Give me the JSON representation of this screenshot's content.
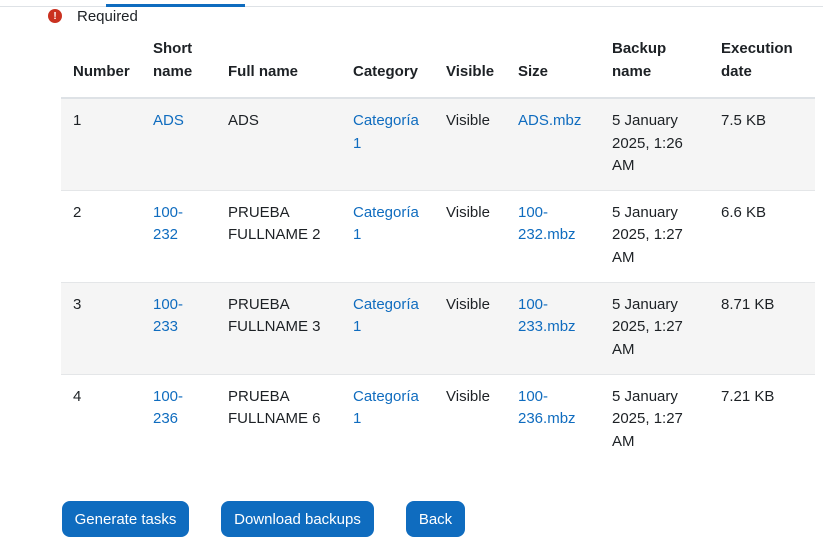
{
  "required_label": "Required",
  "icons": {
    "required": "exclamation-circle-icon"
  },
  "colors": {
    "accent": "#0f6cbf",
    "danger": "#ca3120",
    "stripe": "#f5f5f5"
  },
  "table": {
    "headers": {
      "number": "Number",
      "short_name": [
        "Short",
        "name"
      ],
      "full_name": "Full name",
      "category": "Category",
      "visible": "Visible",
      "size": "Size",
      "backup_name": [
        "Backup",
        "name"
      ],
      "execution_date": [
        "Execution",
        "date"
      ]
    },
    "rows": [
      {
        "number": "1",
        "short_name": [
          "ADS"
        ],
        "full_name": [
          "ADS"
        ],
        "category": [
          "Categoría",
          "1"
        ],
        "visible": "Visible",
        "size": [
          "ADS.mbz"
        ],
        "backup_name": [
          "5 January",
          "2025, 1:26",
          "AM"
        ],
        "execution_date": "7.5 KB"
      },
      {
        "number": "2",
        "short_name": [
          "100-",
          "232"
        ],
        "full_name": [
          "PRUEBA",
          "FULLNAME 2"
        ],
        "category": [
          "Categoría",
          "1"
        ],
        "visible": "Visible",
        "size": [
          "100-",
          "232.mbz"
        ],
        "backup_name": [
          "5 January",
          "2025, 1:27",
          "AM"
        ],
        "execution_date": "6.6 KB"
      },
      {
        "number": "3",
        "short_name": [
          "100-",
          "233"
        ],
        "full_name": [
          "PRUEBA",
          "FULLNAME 3"
        ],
        "category": [
          "Categoría",
          "1"
        ],
        "visible": "Visible",
        "size": [
          "100-",
          "233.mbz"
        ],
        "backup_name": [
          "5 January",
          "2025, 1:27",
          "AM"
        ],
        "execution_date": "8.71 KB"
      },
      {
        "number": "4",
        "short_name": [
          "100-",
          "236"
        ],
        "full_name": [
          "PRUEBA",
          "FULLNAME 6"
        ],
        "category": [
          "Categoría",
          "1"
        ],
        "visible": "Visible",
        "size": [
          "100-",
          "236.mbz"
        ],
        "backup_name": [
          "5 January",
          "2025, 1:27",
          "AM"
        ],
        "execution_date": "7.21 KB"
      }
    ]
  },
  "buttons": {
    "generate": "Generate tasks",
    "download": "Download backups",
    "back": "Back"
  }
}
